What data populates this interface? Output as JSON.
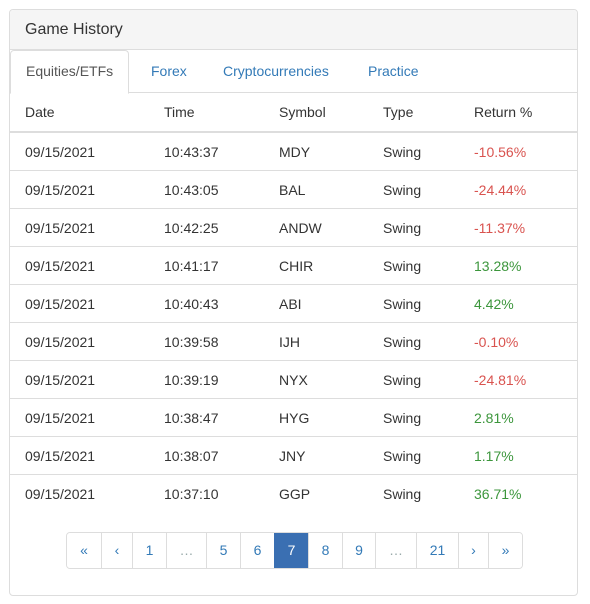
{
  "panel": {
    "title": "Game History"
  },
  "tabs": [
    {
      "label": "Equities/ETFs",
      "active": true
    },
    {
      "label": "Forex",
      "active": false
    },
    {
      "label": "Cryptocurrencies",
      "active": false
    },
    {
      "label": "Practice",
      "active": false
    }
  ],
  "table": {
    "headers": [
      "Date",
      "Time",
      "Symbol",
      "Type",
      "Return %"
    ],
    "rows": [
      {
        "date": "09/15/2021",
        "time": "10:43:37",
        "symbol": "MDY",
        "type": "Swing",
        "return": "-10.56%",
        "sign": "neg"
      },
      {
        "date": "09/15/2021",
        "time": "10:43:05",
        "symbol": "BAL",
        "type": "Swing",
        "return": "-24.44%",
        "sign": "neg"
      },
      {
        "date": "09/15/2021",
        "time": "10:42:25",
        "symbol": "ANDW",
        "type": "Swing",
        "return": "-11.37%",
        "sign": "neg"
      },
      {
        "date": "09/15/2021",
        "time": "10:41:17",
        "symbol": "CHIR",
        "type": "Swing",
        "return": "13.28%",
        "sign": "pos"
      },
      {
        "date": "09/15/2021",
        "time": "10:40:43",
        "symbol": "ABI",
        "type": "Swing",
        "return": "4.42%",
        "sign": "pos"
      },
      {
        "date": "09/15/2021",
        "time": "10:39:58",
        "symbol": "IJH",
        "type": "Swing",
        "return": "-0.10%",
        "sign": "neg"
      },
      {
        "date": "09/15/2021",
        "time": "10:39:19",
        "symbol": "NYX",
        "type": "Swing",
        "return": "-24.81%",
        "sign": "neg"
      },
      {
        "date": "09/15/2021",
        "time": "10:38:47",
        "symbol": "HYG",
        "type": "Swing",
        "return": "2.81%",
        "sign": "pos"
      },
      {
        "date": "09/15/2021",
        "time": "10:38:07",
        "symbol": "JNY",
        "type": "Swing",
        "return": "1.17%",
        "sign": "pos"
      },
      {
        "date": "09/15/2021",
        "time": "10:37:10",
        "symbol": "GGP",
        "type": "Swing",
        "return": "36.71%",
        "sign": "pos"
      }
    ]
  },
  "pagination": {
    "items": [
      {
        "label": "«",
        "name": "first-page-button"
      },
      {
        "label": "‹",
        "name": "prev-page-button"
      },
      {
        "label": "1",
        "name": "page-1-button"
      },
      {
        "label": "…",
        "name": "ellipsis",
        "ellipsis": true
      },
      {
        "label": "5",
        "name": "page-5-button"
      },
      {
        "label": "6",
        "name": "page-6-button"
      },
      {
        "label": "7",
        "name": "page-7-button",
        "active": true
      },
      {
        "label": "8",
        "name": "page-8-button"
      },
      {
        "label": "9",
        "name": "page-9-button"
      },
      {
        "label": "…",
        "name": "ellipsis",
        "ellipsis": true
      },
      {
        "label": "21",
        "name": "page-21-button"
      },
      {
        "label": "›",
        "name": "next-page-button"
      },
      {
        "label": "»",
        "name": "last-page-button"
      }
    ],
    "current_page": 7
  },
  "colors": {
    "negative": "#d9534f",
    "positive": "#3c963c",
    "link": "#337ab7",
    "active_page": "#3a6fb2"
  }
}
